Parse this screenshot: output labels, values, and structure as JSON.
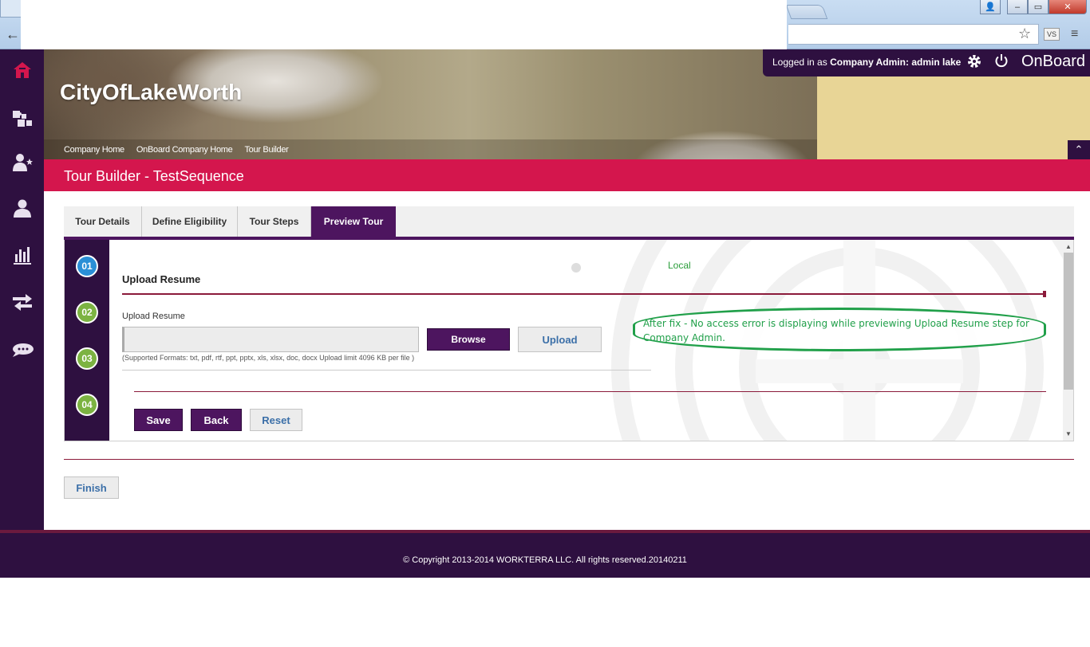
{
  "browser": {
    "back_glyph": "←",
    "star_glyph": "☆",
    "extension_label": "VS",
    "menu_glyph": "≡",
    "minimize_glyph": "–",
    "maximize_glyph": "▭",
    "close_glyph": "✕"
  },
  "header": {
    "company_name": "CityOfLakeWorth",
    "breadcrumb": [
      "Company Home",
      "OnBoard Company Home",
      "Tour Builder"
    ],
    "login_prefix": "Logged in as",
    "login_role": "Company Admin:",
    "login_user": "admin lake",
    "brand": "OnBoard",
    "collapse_glyph": "⌃"
  },
  "sidebar": {
    "items": [
      {
        "icon": "home-icon",
        "glyph": "⌂"
      },
      {
        "icon": "puzzle-icon",
        "glyph": "✤"
      },
      {
        "icon": "user-star-icon",
        "glyph": "✦"
      },
      {
        "icon": "user-icon",
        "glyph": "●"
      },
      {
        "icon": "bar-chart-icon",
        "glyph": "▮"
      },
      {
        "icon": "transfer-icon",
        "glyph": "⇄"
      },
      {
        "icon": "chat-icon",
        "glyph": "◉"
      }
    ]
  },
  "page": {
    "title": "Tour Builder - TestSequence",
    "tabs": [
      "Tour Details",
      "Define Eligibility",
      "Tour Steps",
      "Preview Tour"
    ],
    "active_tab": "Preview Tour"
  },
  "preview": {
    "steps": [
      "01",
      "02",
      "03",
      "04"
    ],
    "current_step": "01",
    "local_label": "Local",
    "form_title": "Upload Resume",
    "upload_label": "Upload Resume",
    "file_value": "",
    "browse_label": "Browse",
    "upload_label_button": "Upload",
    "formats_note": "(Supported Formats: txt, pdf, rtf, ppt, pptx, xls, xlsx, doc, docx Upload limit 4096 KB per file )",
    "annotation": "After fix - No access error is displaying while previewing Upload Resume step for Company Admin.",
    "save_label": "Save",
    "back_label": "Back",
    "reset_label": "Reset",
    "scroll_up": "▲",
    "scroll_down": "▼"
  },
  "actions": {
    "finish_label": "Finish"
  },
  "footer": {
    "copyright": "© Copyright 2013-2014 WORKTERRA LLC. All rights reserved.20140211"
  },
  "colors": {
    "primary_purple": "#4d155f",
    "sidebar_bg": "#2e1040",
    "accent_red": "#d4164d",
    "annotation_green": "#21a04a",
    "step_current": "#2a8fd6",
    "step_pending": "#7cb342"
  }
}
